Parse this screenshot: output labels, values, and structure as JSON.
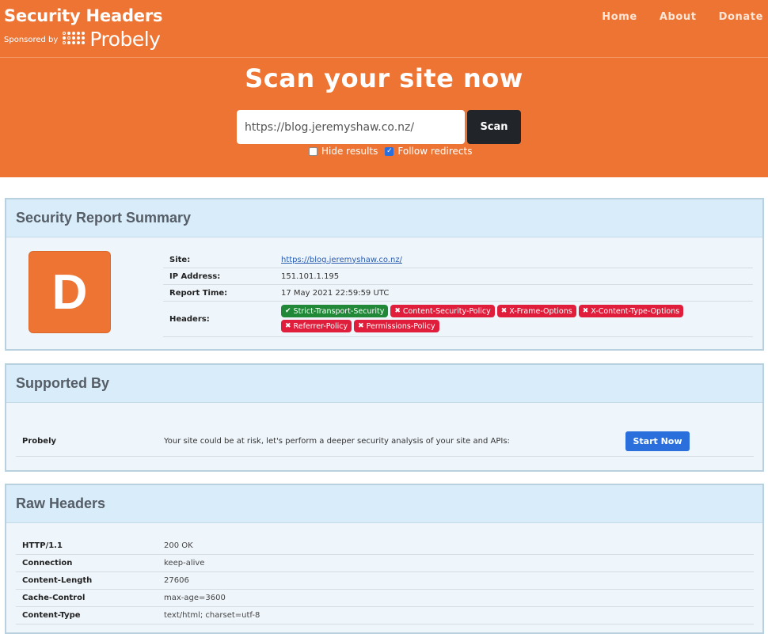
{
  "colors": {
    "brand_orange": "#ee7433",
    "grade_orange": "#ee7433",
    "ok_green": "#218838",
    "fail_red": "#e01e3c",
    "primary_blue": "#2a6fdb"
  },
  "header": {
    "title": "Security Headers",
    "sponsored_by": "Sponsored by",
    "sponsor_name": "Probely",
    "nav": [
      "Home",
      "About",
      "Donate"
    ]
  },
  "scan": {
    "title": "Scan your site now",
    "url_value": "https://blog.jeremyshaw.co.nz/",
    "button": "Scan",
    "hide_results_label": "Hide results",
    "hide_results_checked": false,
    "follow_redirects_label": "Follow redirects",
    "follow_redirects_checked": true
  },
  "summary": {
    "heading": "Security Report Summary",
    "grade": "D",
    "rows": [
      {
        "label": "Site:",
        "value": "https://blog.jeremyshaw.co.nz/"
      },
      {
        "label": "IP Address:",
        "value": "151.101.1.195"
      },
      {
        "label": "Report Time:",
        "value": "17 May 2021 22:59:59 UTC"
      }
    ],
    "headers_label": "Headers:",
    "headers": [
      {
        "name": "Strict-Transport-Security",
        "status": "pass",
        "mark": "✔"
      },
      {
        "name": "Content-Security-Policy",
        "status": "fail",
        "mark": "✖"
      },
      {
        "name": "X-Frame-Options",
        "status": "fail",
        "mark": "✖"
      },
      {
        "name": "X-Content-Type-Options",
        "status": "fail",
        "mark": "✖"
      },
      {
        "name": "Referrer-Policy",
        "status": "fail",
        "mark": "✖"
      },
      {
        "name": "Permissions-Policy",
        "status": "fail",
        "mark": "✖"
      }
    ]
  },
  "supported": {
    "heading": "Supported By",
    "name": "Probely",
    "text": "Your site could be at risk, let's perform a deeper security analysis of your site and APIs:",
    "button": "Start Now"
  },
  "raw": {
    "heading": "Raw Headers",
    "rows": [
      {
        "key": "HTTP/1.1",
        "value": "200 OK"
      },
      {
        "key": "Connection",
        "value": "keep-alive"
      },
      {
        "key": "Content-Length",
        "value": "27606"
      },
      {
        "key": "Cache-Control",
        "value": "max-age=3600"
      },
      {
        "key": "Content-Type",
        "value": "text/html; charset=utf-8"
      }
    ]
  }
}
